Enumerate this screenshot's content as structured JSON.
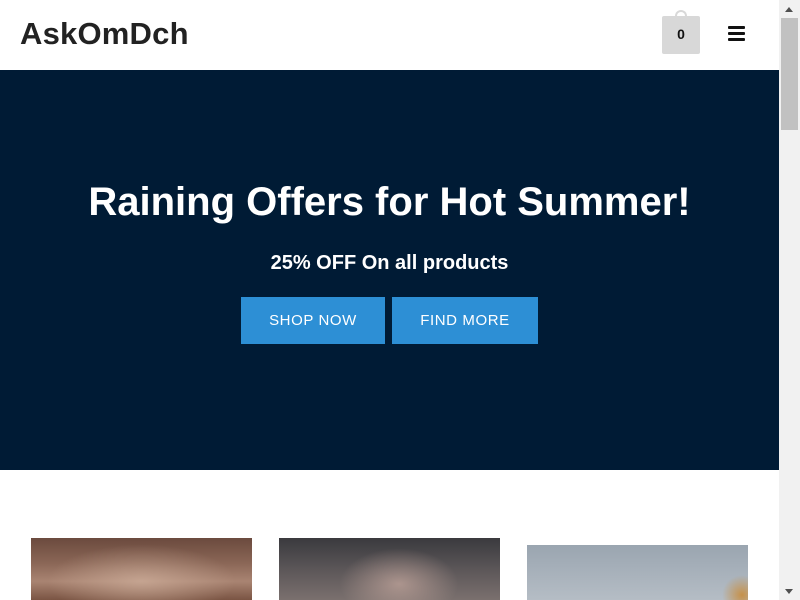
{
  "header": {
    "logo": "AskOmDch",
    "cart_count": "0",
    "icons": {
      "cart": "shopping-bag-icon",
      "menu": "hamburger-menu-icon"
    }
  },
  "hero": {
    "title": "Raining Offers for Hot Summer!",
    "subtitle": "25% OFF On all products",
    "shop_button": "SHOP NOW",
    "find_button": "FIND MORE",
    "colors": {
      "background": "#001b35",
      "button": "#2d8fd5"
    }
  },
  "products": [
    {
      "image": "product-image-woman"
    },
    {
      "image": "product-image-man"
    },
    {
      "image": "product-image-model"
    }
  ]
}
